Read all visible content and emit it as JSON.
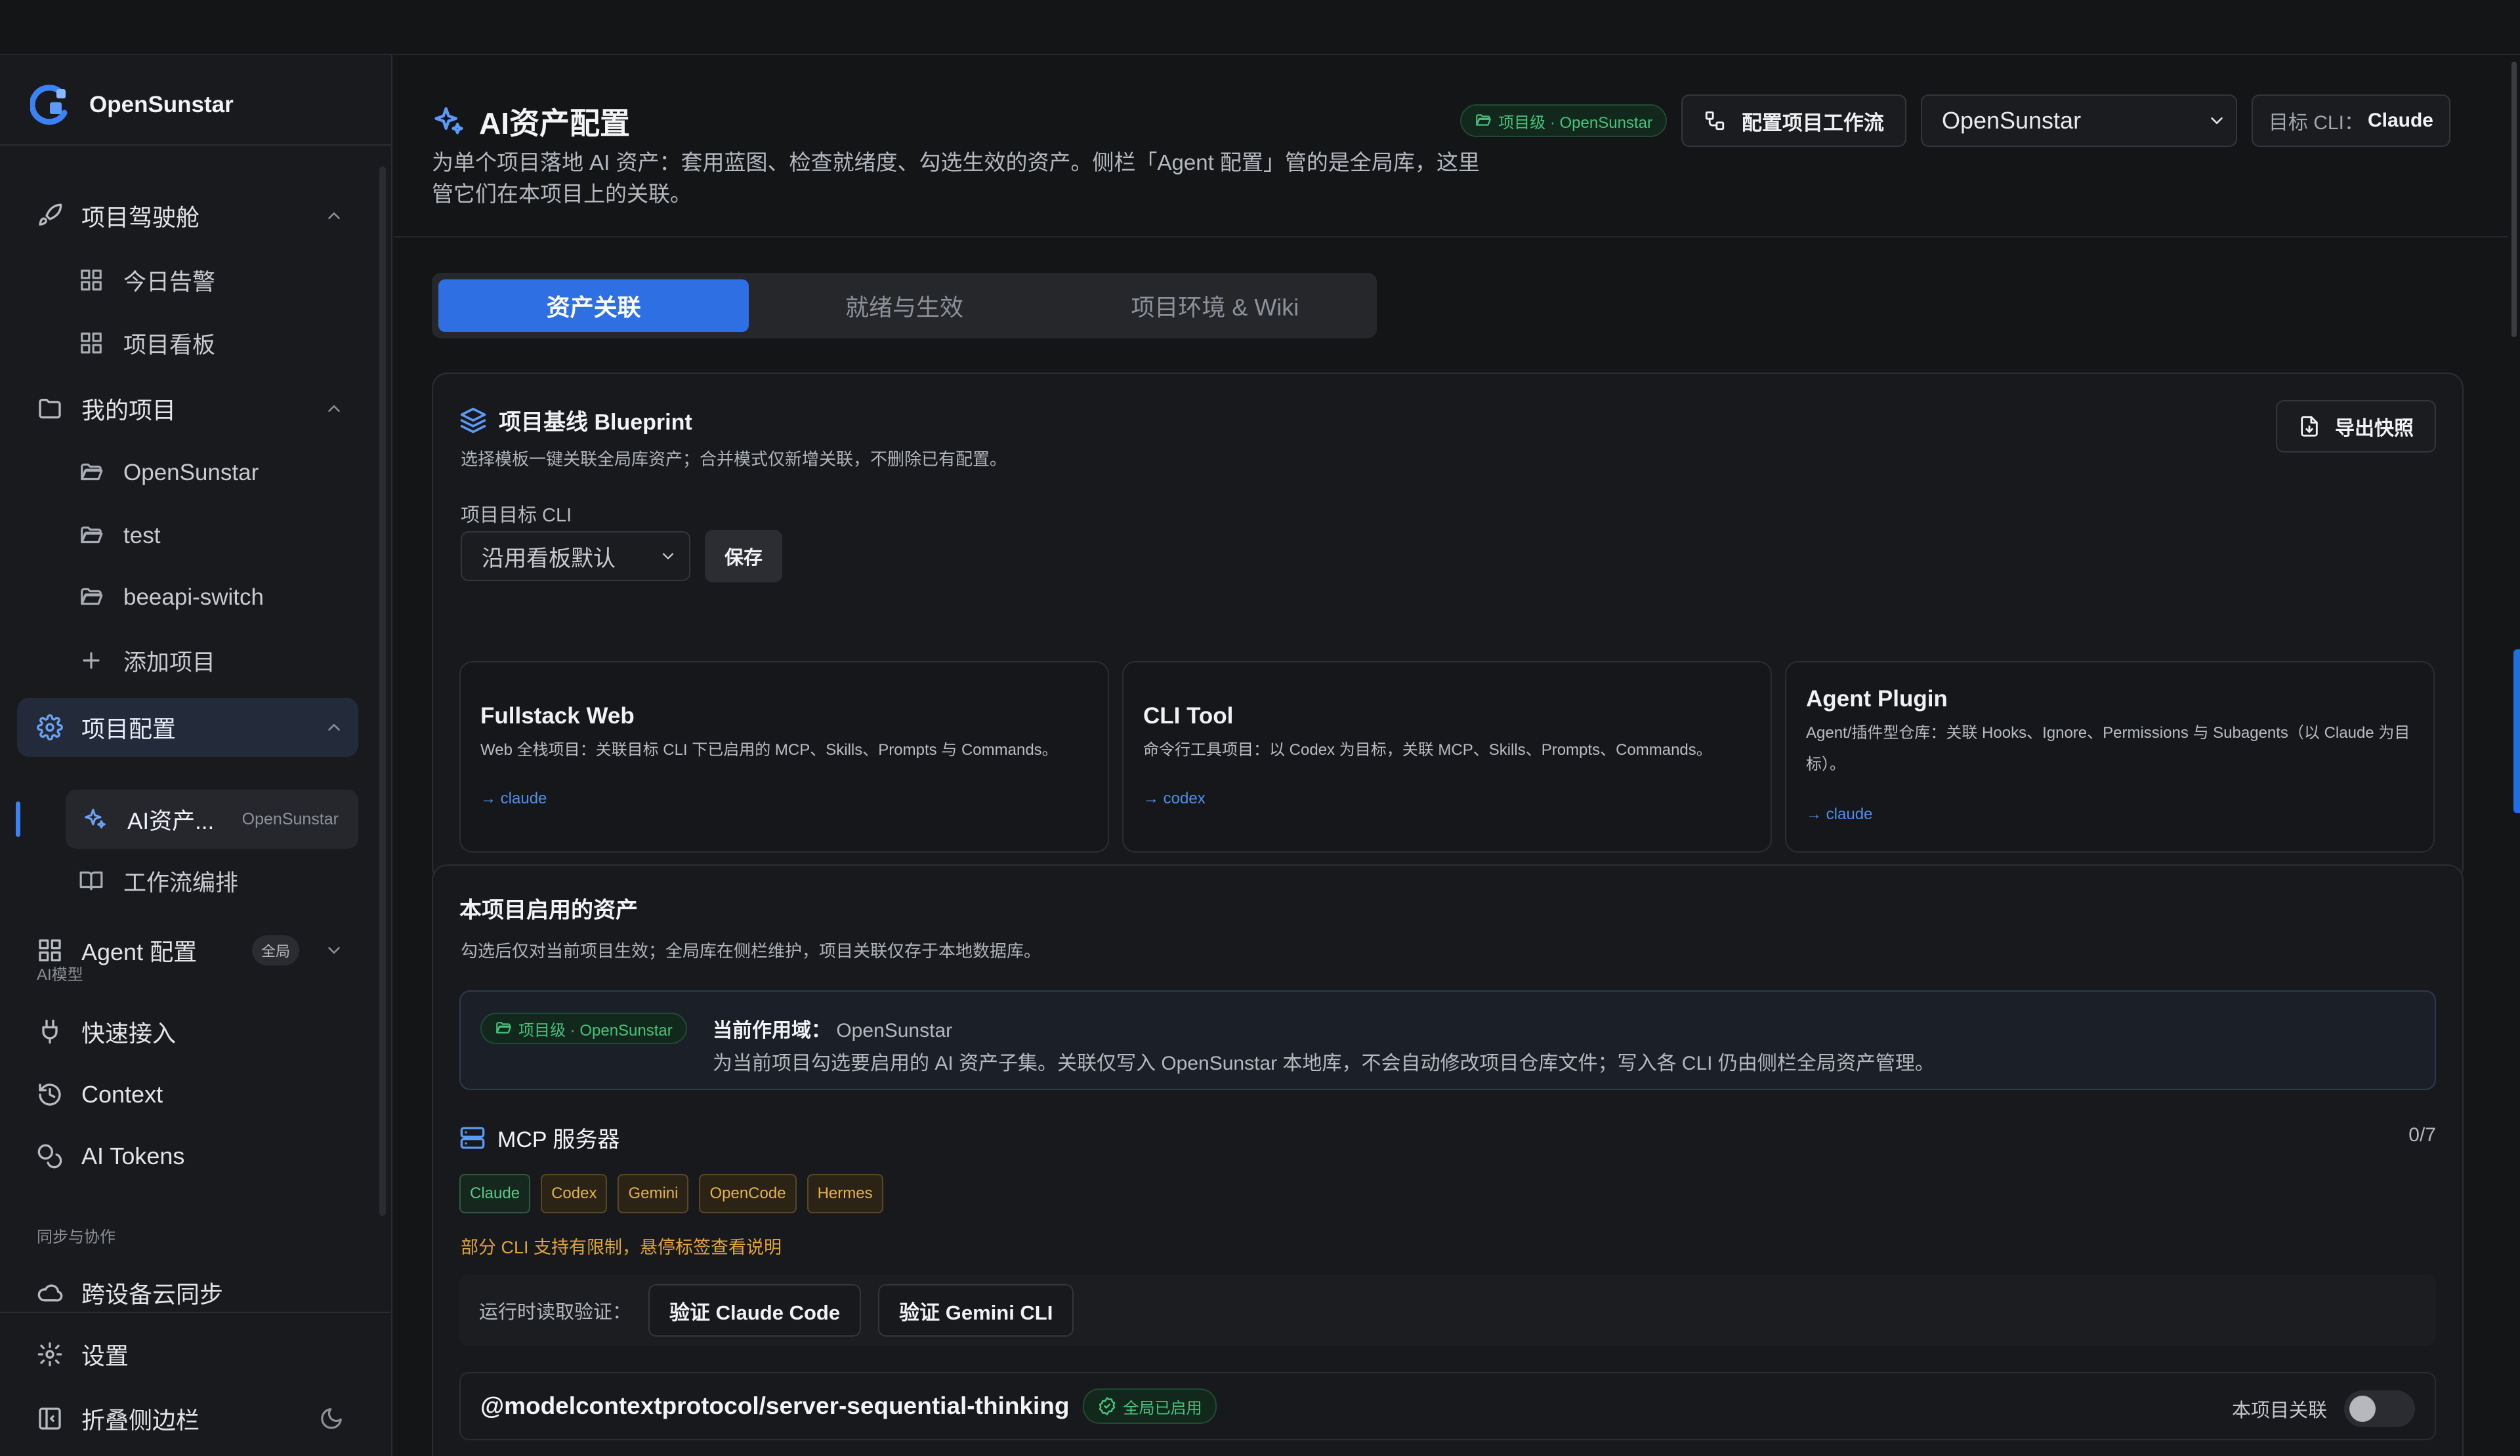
{
  "app": {
    "name": "OpenSunstar"
  },
  "colors": {
    "accent": "#2f6fe4",
    "green": "#46c37c",
    "amber": "#e0a53a",
    "link": "#4f8fea"
  },
  "sidebar": {
    "groups": [
      {
        "label": "项目驾驶舱",
        "icon": "rocket-icon",
        "items": [
          "今日告警",
          "项目看板"
        ]
      },
      {
        "label": "我的项目",
        "icon": "folder-icon",
        "items": [
          "OpenSunstar",
          "test",
          "beeapi-switch"
        ],
        "add_label": "添加项目"
      },
      {
        "label": "项目配置",
        "icon": "gear-icon",
        "active_item": {
          "label": "AI资产...",
          "project": "OpenSunstar"
        },
        "items": [
          "工作流编排"
        ]
      },
      {
        "label": "Agent 配置",
        "icon": "grid-icon",
        "badge": "全局"
      }
    ],
    "section_ai": "AI模型",
    "ai_items": [
      "快速接入",
      "Context",
      "AI Tokens"
    ],
    "section_sync": "同步与协作",
    "sync_items": [
      "跨设备云同步"
    ],
    "settings_label": "设置",
    "collapse_label": "折叠侧边栏"
  },
  "header": {
    "title": "AI资产配置",
    "description": "为单个项目落地 AI 资产：套用蓝图、检查就绪度、勾选生效的资产。侧栏「Agent 配置」管的是全局库，这里管它们在本项目上的关联。",
    "scope_badge": "项目级 · OpenSunstar",
    "workflow_button": "配置项目工作流",
    "project_select": "OpenSunstar",
    "target_cli_label": "目标 CLI：",
    "target_cli_value": "Claude"
  },
  "tabs": [
    "资产关联",
    "就绪与生效",
    "项目环境 & Wiki"
  ],
  "blueprint": {
    "title": "项目基线 Blueprint",
    "subtitle": "选择模板一键关联全局库资产；合并模式仅新增关联，不删除已有配置。",
    "export_button": "导出快照",
    "cli_label": "项目目标 CLI",
    "cli_select": "沿用看板默认",
    "save_button": "保存",
    "templates": [
      {
        "name": "Fullstack Web",
        "desc": "Web 全栈项目：关联目标 CLI 下已启用的 MCP、Skills、Prompts 与 Commands。",
        "link": "→ claude"
      },
      {
        "name": "CLI Tool",
        "desc": "命令行工具项目：以 Codex 为目标，关联 MCP、Skills、Prompts、Commands。",
        "link": "→ codex"
      },
      {
        "name": "Agent Plugin",
        "desc": "Agent/插件型仓库：关联 Hooks、Ignore、Permissions 与 Subagents（以 Claude 为目标）。",
        "link": "→ claude"
      }
    ]
  },
  "enabled": {
    "title": "本项目启用的资产",
    "subtitle": "勾选后仅对当前项目生效；全局库在侧栏维护，项目关联仅存于本地数据库。",
    "scope_badge": "项目级 · OpenSunstar",
    "scope_title": "当前作用域：",
    "scope_value": "OpenSunstar",
    "scope_text": "为当前项目勾选要启用的 AI 资产子集。关联仅写入 OpenSunstar 本地库，不会自动修改项目仓库文件；写入各 CLI 仍由侧栏全局资产管理。",
    "mcp_title": "MCP 服务器",
    "mcp_count": "0/7",
    "cli_tags": [
      "Claude",
      "Codex",
      "Gemini",
      "OpenCode",
      "Hermes"
    ],
    "warning": "部分 CLI 支持有限制，悬停标签查看说明",
    "verify_label": "运行时读取验证：",
    "verify_buttons": [
      "验证 Claude Code",
      "验证 Gemini CLI"
    ],
    "server_name": "@modelcontextprotocol/server-sequential-thinking",
    "server_badge": "全局已启用",
    "toggle_label": "本项目关联"
  }
}
